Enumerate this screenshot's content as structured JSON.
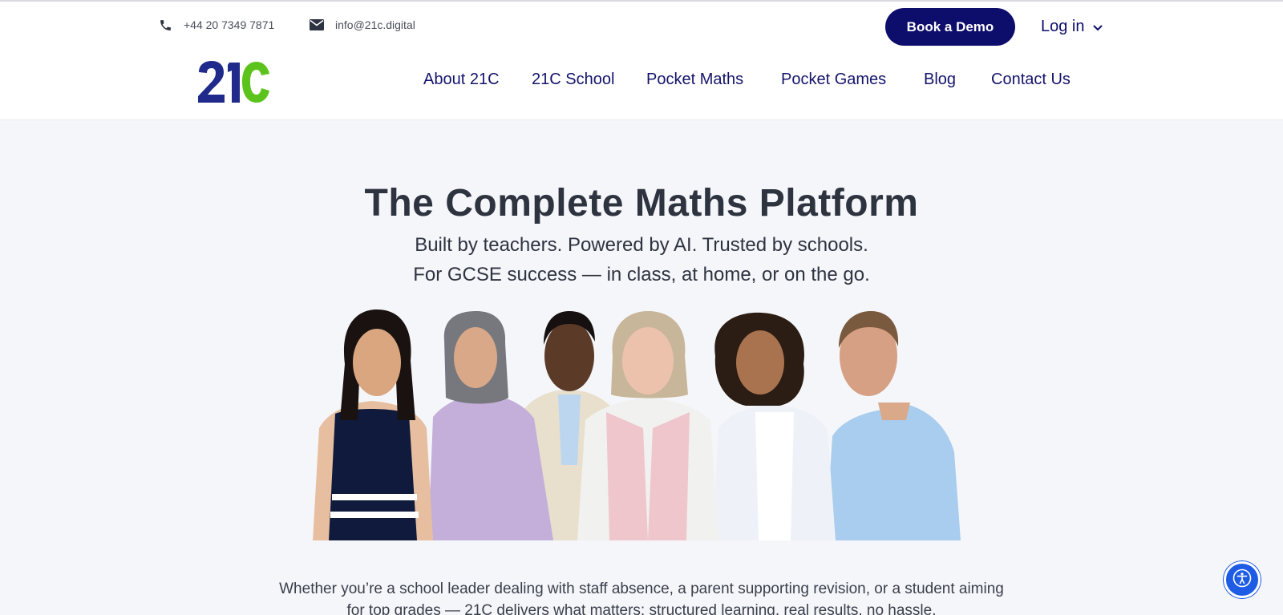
{
  "topbar": {
    "phone": "+44 20 7349 7871",
    "email": "info@21c.digital",
    "demo_label": "Book a Demo",
    "login_label": "Log in"
  },
  "nav": {
    "items": [
      {
        "label": "About 21C"
      },
      {
        "label": "21C School"
      },
      {
        "label": "Pocket Maths"
      },
      {
        "label": "Pocket Games"
      },
      {
        "label": "Blog"
      },
      {
        "label": "Contact Us"
      }
    ]
  },
  "hero": {
    "title": "The Complete Maths Platform",
    "subtitle_line1": "Built by teachers. Powered by AI. Trusted by schools.",
    "subtitle_line2": "For GCSE success — in class, at home, or on the go."
  },
  "intro": {
    "line1": "Whether you’re a school leader dealing with staff absence, a parent supporting revision, or a student aiming",
    "line2": "for top grades — 21C delivers what matters: structured learning, real results, no hassle."
  },
  "colors": {
    "brand_navy": "#0d0d6b",
    "logo_blue": "#1f2a8a",
    "logo_green": "#5cc31c",
    "hero_bg": "#f5f6fa",
    "accessibility_blue": "#1e5ce6"
  },
  "icons": [
    "phone-icon",
    "envelope-icon",
    "chevron-down-icon",
    "accessibility-icon"
  ]
}
